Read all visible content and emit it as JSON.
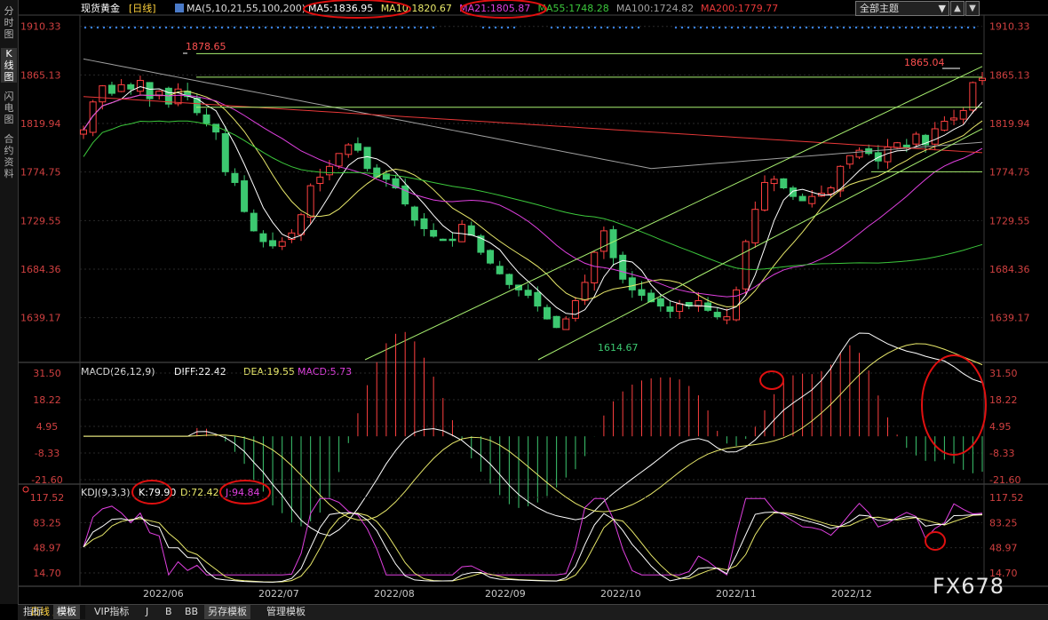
{
  "sidebar": {
    "tabs": [
      "分时图",
      "K线图",
      "闪电图",
      "合约资料"
    ],
    "active": 1
  },
  "header": {
    "symbol": "现货黄金",
    "period": "[日线]",
    "ma_label": "MA(5,10,21,55,100,200)",
    "ma": [
      {
        "name": "MA5",
        "value": "1836.95",
        "color": "#ffffff"
      },
      {
        "name": "MA10",
        "value": "1820.67",
        "color": "#e8e86a"
      },
      {
        "name": "MA21",
        "value": "1805.87",
        "color": "#e040e0"
      },
      {
        "name": "MA55",
        "value": "1748.28",
        "color": "#3cc83c"
      },
      {
        "name": "MA100",
        "value": "1724.82",
        "color": "#a0a0a0"
      },
      {
        "name": "MA200",
        "value": "1779.77",
        "color": "#e83838"
      }
    ],
    "theme_dropdown": "全部主题",
    "up_btn": "▲",
    "down_btn": "▼"
  },
  "price_axis": [
    "1910.33",
    "1865.13",
    "1819.94",
    "1774.75",
    "1729.55",
    "1684.36",
    "1639.17"
  ],
  "annotations": {
    "high": "1878.65",
    "low": "1614.67",
    "recent_high": "1865.04"
  },
  "macd": {
    "label": "MACD(26,12,9)",
    "diff": "DIFF:22.42",
    "dea": "DEA:19.55",
    "macd": "MACD:5.73",
    "axis": [
      "31.50",
      "18.22",
      "4.95",
      "-8.33",
      "-21.60"
    ]
  },
  "kdj": {
    "label": "KDJ(9,3,3)",
    "k": "K:79.90",
    "d": "D:72.42",
    "j": "J:94.84",
    "axis": [
      "117.52",
      "83.25",
      "48.97",
      "14.70"
    ]
  },
  "time_axis": [
    "2022/06",
    "2022/07",
    "2022/08",
    "2022/09",
    "2022/10",
    "2022/11",
    "2022/12"
  ],
  "bottom": {
    "period": "日线",
    "tabs": [
      "指标",
      "模板",
      "VIP指标",
      "J",
      "B",
      "BB",
      "另存模板",
      "管理模板"
    ]
  },
  "watermark": "FX678",
  "chart_data": {
    "type": "candlestick",
    "title": "现货黄金 [日线]",
    "x": [
      "2022/06",
      "2022/07",
      "2022/08",
      "2022/09",
      "2022/10",
      "2022/11",
      "2022/12"
    ],
    "ylim": [
      1600,
      1920
    ],
    "price_path": [
      1814,
      1840,
      1855,
      1848,
      1856,
      1852,
      1860,
      1843,
      1850,
      1838,
      1852,
      1845,
      1830,
      1820,
      1812,
      1775,
      1765,
      1738,
      1720,
      1710,
      1706,
      1710,
      1718,
      1735,
      1762,
      1770,
      1780,
      1792,
      1800,
      1795,
      1778,
      1770,
      1768,
      1760,
      1745,
      1730,
      1722,
      1715,
      1712,
      1712,
      1726,
      1716,
      1700,
      1690,
      1680,
      1670,
      1665,
      1660,
      1650,
      1638,
      1630,
      1638,
      1655,
      1672,
      1700,
      1720,
      1695,
      1675,
      1665,
      1660,
      1654,
      1650,
      1645,
      1652,
      1650,
      1655,
      1646,
      1640,
      1640,
      1665,
      1710,
      1740,
      1765,
      1768,
      1760,
      1752,
      1748,
      1752,
      1755,
      1760,
      1780,
      1790,
      1795,
      1792,
      1785,
      1798,
      1802,
      1798,
      1810,
      1800,
      1815,
      1822,
      1825,
      1832,
      1858,
      1862
    ]
  }
}
